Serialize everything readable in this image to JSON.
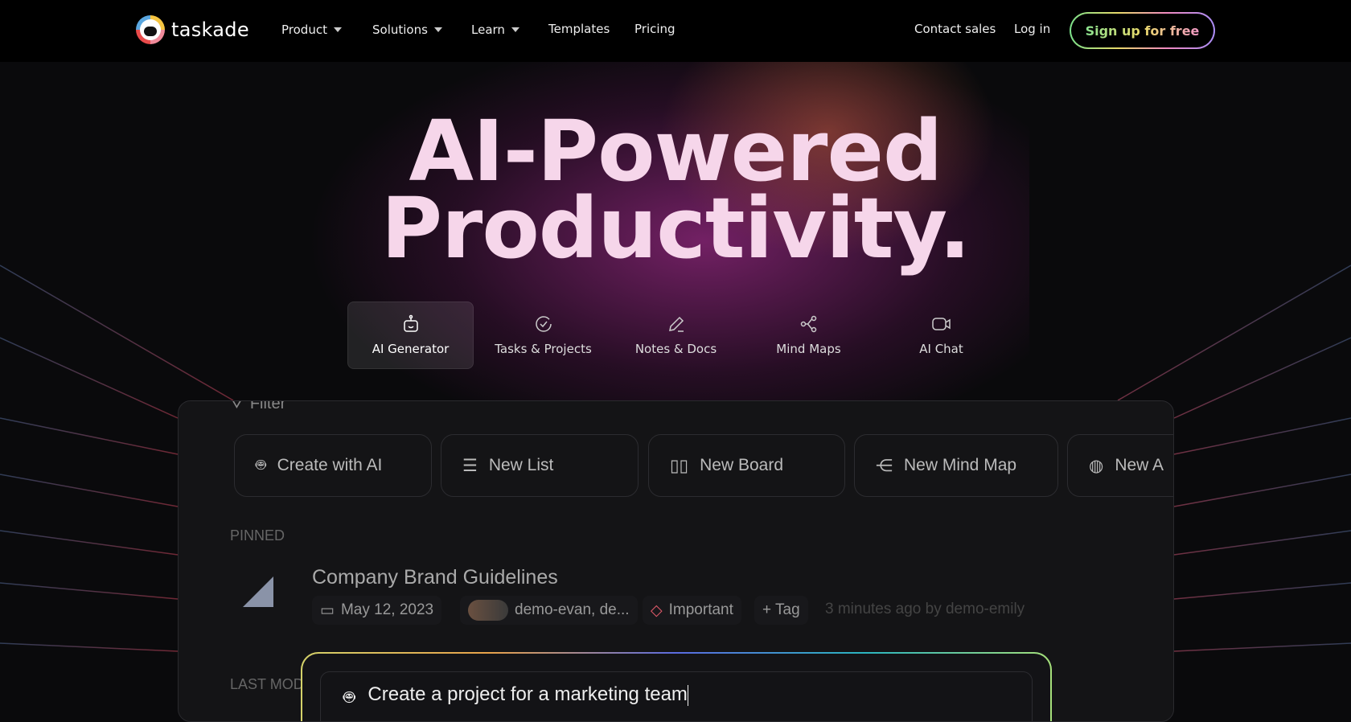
{
  "nav": {
    "brand": "taskade",
    "items": [
      {
        "label": "Product",
        "dropdown": true
      },
      {
        "label": "Solutions",
        "dropdown": true
      },
      {
        "label": "Learn",
        "dropdown": true
      },
      {
        "label": "Templates"
      },
      {
        "label": "Pricing"
      }
    ],
    "contact": "Contact sales",
    "login": "Log in",
    "signup": "Sign up for free"
  },
  "hero": {
    "line1": "AI-Powered",
    "line2": "Productivity."
  },
  "tabs": [
    {
      "label": "AI Generator",
      "icon": "robot-icon",
      "active": true
    },
    {
      "label": "Tasks & Projects",
      "icon": "check-circle-icon"
    },
    {
      "label": "Notes & Docs",
      "icon": "pencil-icon"
    },
    {
      "label": "Mind Maps",
      "icon": "share-nodes-icon"
    },
    {
      "label": "AI Chat",
      "icon": "video-icon"
    }
  ],
  "panel": {
    "filter": "Filter",
    "quick": [
      {
        "label": "Create with AI",
        "icon": "robot-icon"
      },
      {
        "label": "New List",
        "icon": "list-icon"
      },
      {
        "label": "New Board",
        "icon": "board-icon"
      },
      {
        "label": "New Mind Map",
        "icon": "share-nodes-icon"
      },
      {
        "label": "New A",
        "icon": "globe-icon"
      }
    ],
    "pinned_label": "PINNED",
    "project": {
      "title": "Company Brand Guidelines",
      "date": "May 12, 2023",
      "members": "demo-evan, de...",
      "tag": "Important",
      "add_tag": "+ Tag",
      "updated": "3 minutes ago by demo-emily"
    },
    "last_label": "LAST MOD",
    "ai_prompt": "Create a project for a marketing team"
  },
  "colors": {
    "accent": "#f6d6ea",
    "tag": "#e05a6a"
  }
}
